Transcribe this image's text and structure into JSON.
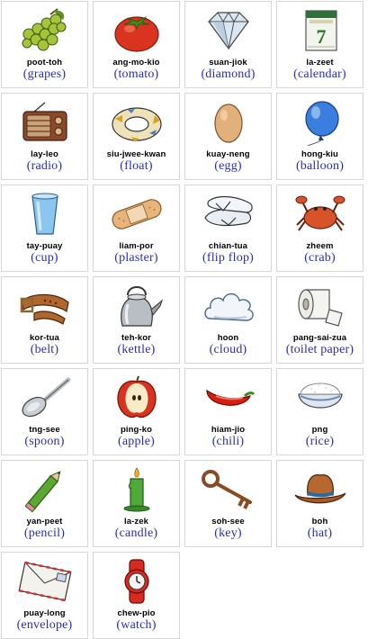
{
  "items": [
    {
      "romanized": "poot-toh",
      "english": "(grapes)",
      "icon": "grapes-icon"
    },
    {
      "romanized": "ang-mo-kio",
      "english": "(tomato)",
      "icon": "tomato-icon"
    },
    {
      "romanized": "suan-jiok",
      "english": "(diamond)",
      "icon": "diamond-icon"
    },
    {
      "romanized": "la-zeet",
      "english": "(calendar)",
      "icon": "calendar-icon",
      "calendar_number": "7"
    },
    {
      "romanized": "lay-leo",
      "english": "(radio)",
      "icon": "radio-icon"
    },
    {
      "romanized": "siu-jwee-kwan",
      "english": "(float)",
      "icon": "float-icon"
    },
    {
      "romanized": "kuay-neng",
      "english": "(egg)",
      "icon": "egg-icon"
    },
    {
      "romanized": "hong-kiu",
      "english": "(balloon)",
      "icon": "balloon-icon"
    },
    {
      "romanized": "tay-puay",
      "english": "(cup)",
      "icon": "cup-icon"
    },
    {
      "romanized": "liam-por",
      "english": "(plaster)",
      "icon": "plaster-icon"
    },
    {
      "romanized": "chian-tua",
      "english": "(flip flop)",
      "icon": "flip-flop-icon"
    },
    {
      "romanized": "zheem",
      "english": "(crab)",
      "icon": "crab-icon"
    },
    {
      "romanized": "kor-tua",
      "english": "(belt)",
      "icon": "belt-icon"
    },
    {
      "romanized": "teh-kor",
      "english": "(kettle)",
      "icon": "kettle-icon"
    },
    {
      "romanized": "hoon",
      "english": "(cloud)",
      "icon": "cloud-icon"
    },
    {
      "romanized": "pang-sai-zua",
      "english": "(toilet paper)",
      "icon": "toilet-paper-icon"
    },
    {
      "romanized": "tng-see",
      "english": "(spoon)",
      "icon": "spoon-icon"
    },
    {
      "romanized": "ping-ko",
      "english": "(apple)",
      "icon": "apple-icon"
    },
    {
      "romanized": "hiam-jio",
      "english": "(chili)",
      "icon": "chili-icon"
    },
    {
      "romanized": "png",
      "english": "(rice)",
      "icon": "rice-icon"
    },
    {
      "romanized": "yan-peet",
      "english": "(pencil)",
      "icon": "pencil-icon"
    },
    {
      "romanized": "la-zek",
      "english": "(candle)",
      "icon": "candle-icon"
    },
    {
      "romanized": "soh-see",
      "english": "(key)",
      "icon": "key-icon"
    },
    {
      "romanized": "boh",
      "english": "(hat)",
      "icon": "hat-icon"
    },
    {
      "romanized": "puay-long",
      "english": "(envelope)",
      "icon": "envelope-icon"
    },
    {
      "romanized": "chew-pio",
      "english": "(watch)",
      "icon": "watch-icon"
    }
  ],
  "colors": {
    "english_text": "#2b2bb3",
    "romanized_text": "#000000",
    "card_border": "#d6d6d6"
  }
}
